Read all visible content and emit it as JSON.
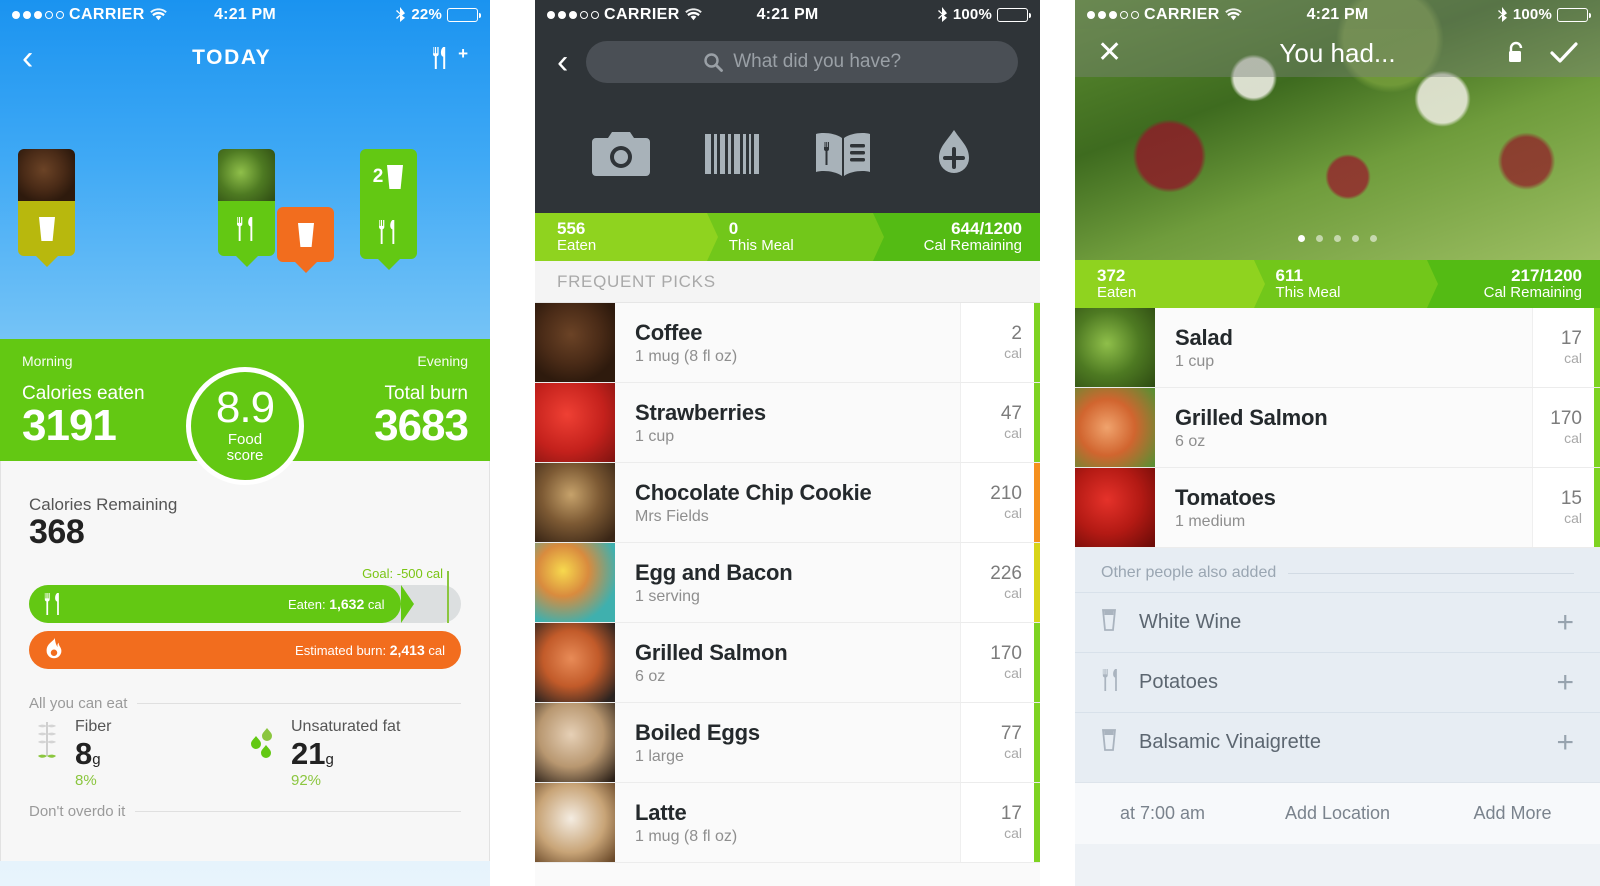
{
  "panel1": {
    "status": {
      "carrier": "CARRIER",
      "time": "4:21 PM",
      "battery_pct": "22%",
      "signal_filled": 3,
      "signal_hollow": 2
    },
    "nav": {
      "back_icon": "chevron-left-icon",
      "title": "TODAY",
      "add_meal_icon": "fork-knife-plus-icon"
    },
    "timeline": {
      "markers": [
        {
          "kind": "photo-drink",
          "color": "#b8b80d",
          "label": "",
          "icon": "glass-icon",
          "photo": "coffee"
        },
        {
          "kind": "photo-meal",
          "color": "#63c813",
          "label": "",
          "icon": "fork-knife-icon",
          "photo": "salad"
        },
        {
          "kind": "drink",
          "color": "#f26d1e",
          "label": "",
          "icon": "glass-icon"
        },
        {
          "kind": "count-meal",
          "color": "#63c813",
          "label": "2",
          "icon": "fork-knife-icon"
        }
      ]
    },
    "summary": {
      "left_label": "Morning",
      "right_label": "Evening",
      "eaten_label": "Calories eaten",
      "eaten_value": "3191",
      "burn_label": "Total burn",
      "burn_value": "3683",
      "score_value": "8.9",
      "score_label_line1": "Food",
      "score_label_line2": "score"
    },
    "remaining": {
      "label": "Calories Remaining",
      "value": "368",
      "goal": "Goal: -500 cal",
      "eaten_bar": {
        "prefix": "Eaten:",
        "value": "1,632",
        "unit": "cal",
        "icon": "fork-knife-icon",
        "color": "#63c813"
      },
      "burn_bar": {
        "prefix": "Estimated burn:",
        "value": "2,413",
        "unit": "cal",
        "icon": "flame-icon",
        "color": "#f26d1e"
      }
    },
    "nutrition": {
      "good_header": "All you can eat",
      "bad_header": "Don't overdo it",
      "items": [
        {
          "icon": "wheat-icon",
          "label": "Fiber",
          "value": "8",
          "unit": "g",
          "pct": "8%"
        },
        {
          "icon": "droplets-icon",
          "label": "Unsaturated fat",
          "value": "21",
          "unit": "g",
          "pct": "92%"
        }
      ]
    }
  },
  "panel2": {
    "status": {
      "carrier": "CARRIER",
      "time": "4:21 PM",
      "battery_pct": "100%",
      "signal_filled": 3,
      "signal_hollow": 2
    },
    "search": {
      "back_icon": "chevron-left-icon",
      "placeholder": "What did you have?",
      "value": "",
      "search_icon": "search-icon"
    },
    "quick_actions": [
      {
        "icon": "camera-icon",
        "name": "photo"
      },
      {
        "icon": "barcode-icon",
        "name": "barcode"
      },
      {
        "icon": "menu-book-icon",
        "name": "restaurant-menu"
      },
      {
        "icon": "water-drop-plus-icon",
        "name": "add-water"
      }
    ],
    "calbar": {
      "eaten_value": "556",
      "eaten_label": "Eaten",
      "meal_value": "0",
      "meal_label": "This Meal",
      "remaining_value": "644/1200",
      "remaining_label": "Cal Remaining"
    },
    "section_title": "FREQUENT PICKS",
    "foods": [
      {
        "name": "Coffee",
        "sub": "1 mug (8 fl oz)",
        "cal": "2",
        "unit": "cal",
        "flag": "#7ed321",
        "img": "img-coffee"
      },
      {
        "name": "Strawberries",
        "sub": "1 cup",
        "cal": "47",
        "unit": "cal",
        "flag": "#7ed321",
        "img": "img-straw"
      },
      {
        "name": "Chocolate Chip Cookie",
        "sub": "Mrs Fields",
        "cal": "210",
        "unit": "cal",
        "flag": "#f5901e",
        "img": "img-cookie"
      },
      {
        "name": "Egg and Bacon",
        "sub": "1 serving",
        "cal": "226",
        "unit": "cal",
        "flag": "#d8d419",
        "img": "img-eggbacon"
      },
      {
        "name": "Grilled Salmon",
        "sub": "6 oz",
        "cal": "170",
        "unit": "cal",
        "flag": "#7ed321",
        "img": "img-salmon"
      },
      {
        "name": "Boiled Eggs",
        "sub": "1 large",
        "cal": "77",
        "unit": "cal",
        "flag": "#7ed321",
        "img": "img-eggs"
      },
      {
        "name": "Latte",
        "sub": "1 mug (8 fl oz)",
        "cal": "17",
        "unit": "cal",
        "flag": "#7ed321",
        "img": "img-latte"
      }
    ]
  },
  "panel3": {
    "status": {
      "carrier": "CARRIER",
      "time": "4:21 PM",
      "battery_pct": "100%",
      "signal_filled": 3,
      "signal_hollow": 2
    },
    "nav": {
      "close_icon": "close-icon",
      "title": "You had...",
      "lock_icon": "unlock-icon",
      "confirm_icon": "check-icon"
    },
    "carousel": {
      "total": 5,
      "active": 1
    },
    "calbar": {
      "eaten_value": "372",
      "eaten_label": "Eaten",
      "meal_value": "611",
      "meal_label": "This Meal",
      "remaining_value": "217/1200",
      "remaining_label": "Cal Remaining"
    },
    "foods": [
      {
        "name": "Salad",
        "sub": "1 cup",
        "cal": "17",
        "unit": "cal",
        "flag": "#7ed321",
        "img": "img-salad"
      },
      {
        "name": "Grilled Salmon",
        "sub": "6 oz",
        "cal": "170",
        "unit": "cal",
        "flag": "#7ed321",
        "img": "img-salmon2"
      },
      {
        "name": "Tomatoes",
        "sub": "1 medium",
        "cal": "15",
        "unit": "cal",
        "flag": "#7ed321",
        "img": "img-tomato"
      }
    ],
    "others_header": "Other people also added",
    "others": [
      {
        "name": "White Wine",
        "icon": "glass-icon",
        "add_icon": "plus-icon"
      },
      {
        "name": "Potatoes",
        "icon": "fork-knife-icon",
        "add_icon": "plus-icon"
      },
      {
        "name": "Balsamic Vinaigrette",
        "icon": "glass-icon",
        "add_icon": "plus-icon"
      }
    ],
    "footer": [
      {
        "label": "at 7:00 am",
        "name": "time-button"
      },
      {
        "label": "Add Location",
        "name": "add-location-button"
      },
      {
        "label": "Add More",
        "name": "add-more-button"
      }
    ]
  }
}
